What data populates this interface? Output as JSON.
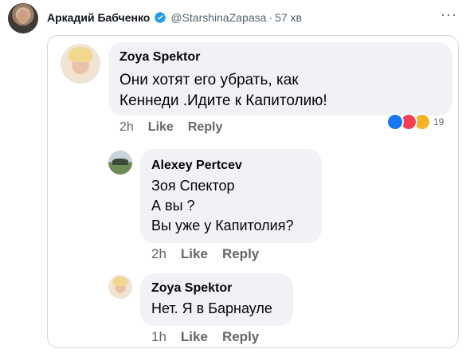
{
  "tweet": {
    "author_name": "Аркадий Бабченко",
    "handle": "@StarshinaZapasa",
    "separator": "·",
    "time": "57 хв",
    "more_icon": "more-dots-icon",
    "verified_icon": "verified-badge-icon",
    "accent_color": "#1d9bf0"
  },
  "screenshot": {
    "comments": [
      {
        "author": "Zoya Spektor",
        "lines": [
          "Они хотят его убрать, как",
          "Кеннеди .Идите к Капитолию!"
        ],
        "age": "2h",
        "like_label": "Like",
        "reply_label": "Reply",
        "reaction_count": "19",
        "reaction_icons": [
          "like-reaction-icon",
          "love-reaction-icon",
          "haha-reaction-icon"
        ]
      },
      {
        "author": "Alexey Pertcev",
        "lines": [
          "Зоя Спектор",
          "А вы ?",
          "Вы уже у Капитолия?"
        ],
        "age": "2h",
        "like_label": "Like",
        "reply_label": "Reply"
      },
      {
        "author": "Zoya Spektor",
        "lines": [
          "Нет. Я в Барнауле"
        ],
        "age": "1h",
        "like_label": "Like",
        "reply_label": "Reply"
      }
    ]
  }
}
